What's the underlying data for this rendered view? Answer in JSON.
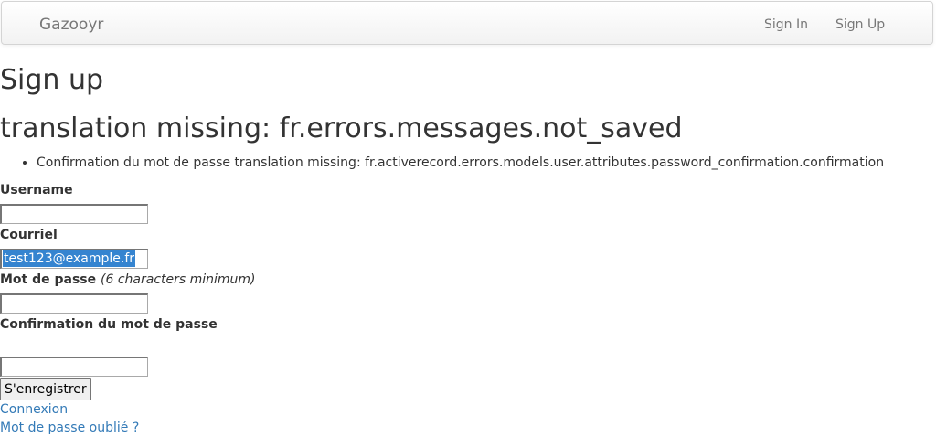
{
  "navbar": {
    "brand": "Gazooyr",
    "links": [
      {
        "label": "Sign In"
      },
      {
        "label": "Sign Up"
      }
    ]
  },
  "page": {
    "title": "Sign up",
    "error_heading": "translation missing: fr.errors.messages.not_saved",
    "errors": [
      "Confirmation du mot de passe translation missing: fr.activerecord.errors.models.user.attributes.password_confirmation.confirmation"
    ]
  },
  "form": {
    "username": {
      "label": "Username",
      "value": ""
    },
    "email": {
      "label": "Courriel",
      "value": "test123@example.fr"
    },
    "password": {
      "label": "Mot de passe",
      "hint": "(6 characters minimum)",
      "value": ""
    },
    "password_confirmation": {
      "label": "Confirmation du mot de passe",
      "value": ""
    },
    "submit_label": "S'enregistrer"
  },
  "links": {
    "login": "Connexion",
    "forgot_password": "Mot de passe oublié ?"
  }
}
